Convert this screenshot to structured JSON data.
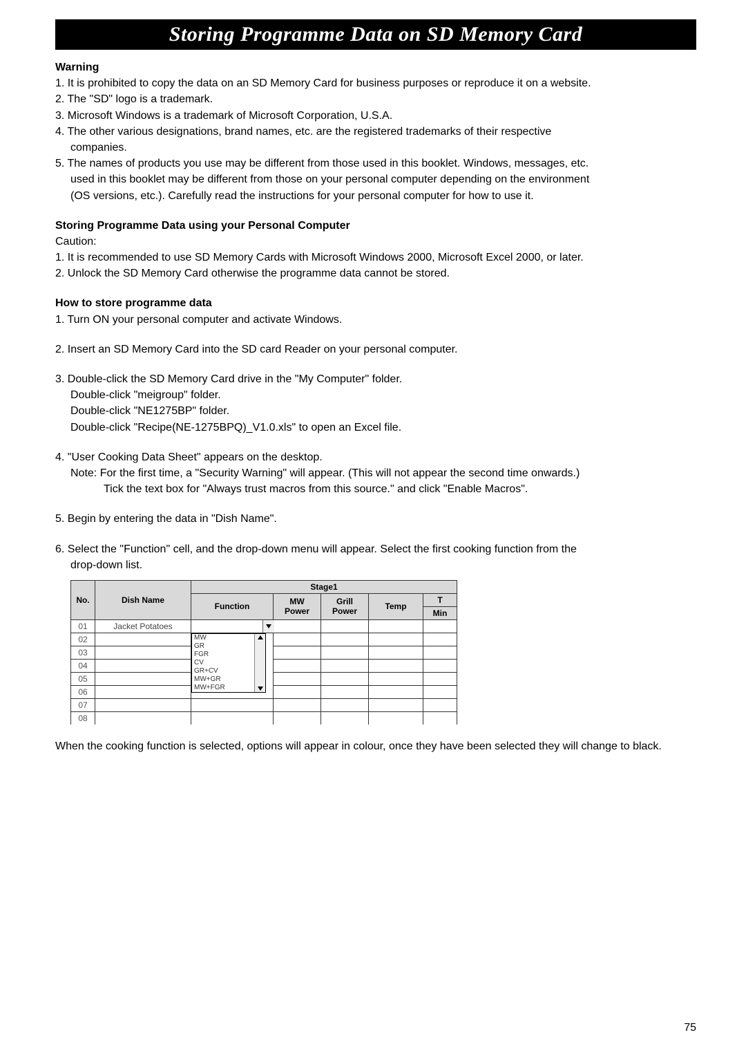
{
  "banner": {
    "title": "Storing Programme Data on SD Memory Card"
  },
  "warning": {
    "title": "Warning",
    "items": [
      "1. It is prohibited to copy the data on an SD Memory Card for business purposes or reproduce it on a website.",
      "2. The \"SD\" logo is a trademark.",
      "3. Microsoft Windows is a trademark of Microsoft Corporation, U.S.A.",
      "4. The other various designations, brand names, etc. are the registered trademarks of their respective",
      "5. The names of products you use may be different from those used in this booklet. Windows, messages, etc."
    ],
    "sub4": "companies.",
    "sub5a": "used in this booklet may be different from those on your personal computer depending on the environment",
    "sub5b": "(OS versions, etc.). Carefully read the instructions for your personal computer for how to use it."
  },
  "storing": {
    "title": "Storing Programme Data using your Personal Computer",
    "caution": "Caution:",
    "items": [
      "1. It is recommended to use SD Memory Cards with Microsoft Windows 2000, Microsoft Excel 2000, or later.",
      "2. Unlock the SD Memory Card otherwise the programme data cannot be stored."
    ]
  },
  "howto": {
    "title": "How to store programme data",
    "step1": "1. Turn ON your personal computer and activate Windows.",
    "step2": "2. Insert an SD Memory Card into the SD card Reader on your personal computer.",
    "step3": {
      "line1": "3. Double-click the SD Memory Card drive in the \"My Computer\" folder.",
      "line2": "Double-click \"meigroup\" folder.",
      "line3": "Double-click \"NE1275BP\" folder.",
      "line4": "Double-click \"Recipe(NE-1275BPQ)_V1.0.xls\" to open an Excel file."
    },
    "step4": {
      "line1": "4. \"User Cooking Data Sheet\" appears on the desktop.",
      "note1": "Note: For the first time, a \"Security Warning\" will appear. (This will not appear the second time onwards.)",
      "note2": "Tick the text box for \"Always trust macros from this source.\" and click \"Enable Macros\"."
    },
    "step5": "5. Begin by entering the data in \"Dish Name\".",
    "step6": {
      "line1": "6. Select the \"Function\" cell, and the drop-down menu will appear. Select the first cooking function from the",
      "line2": "drop-down list."
    }
  },
  "excel": {
    "headers": {
      "no": "No.",
      "dish": "Dish Name",
      "stage": "Stage1",
      "function": "Function",
      "mw": "MW Power",
      "grill": "Grill Power",
      "temp": "Temp",
      "min": "Min"
    },
    "rows": [
      "01",
      "02",
      "03",
      "04",
      "05",
      "06",
      "07",
      "08"
    ],
    "dish01": "Jacket Potatoes",
    "dropdown": [
      "MW",
      "GR",
      "FGR",
      "CV",
      "GR+CV",
      "MW+GR",
      "MW+FGR"
    ]
  },
  "footer": {
    "note": "When the cooking function is selected, options will appear in colour, once they have been selected they will change to black."
  },
  "pageNumber": "75"
}
